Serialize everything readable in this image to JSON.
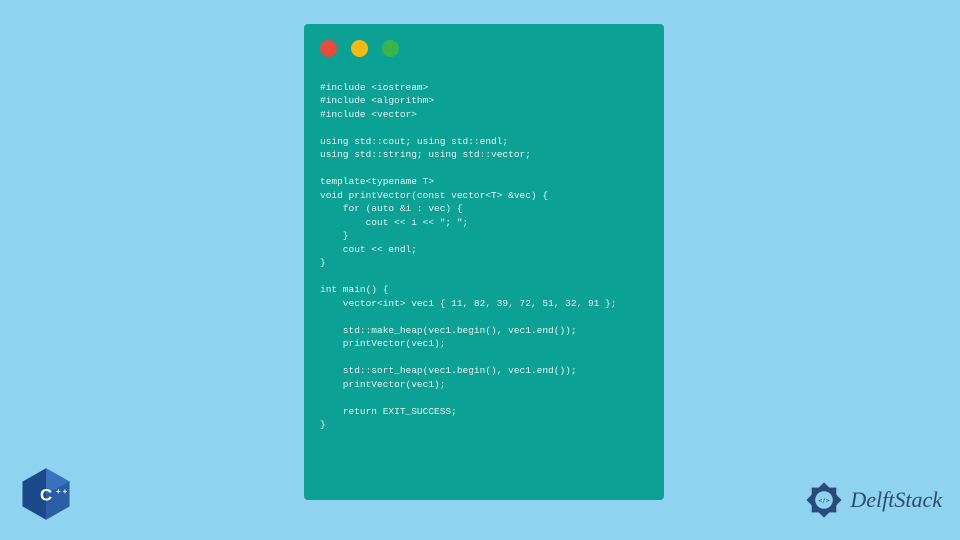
{
  "code": {
    "lines": "#include <iostream>\n#include <algorithm>\n#include <vector>\n\nusing std::cout; using std::endl;\nusing std::string; using std::vector;\n\ntemplate<typename T>\nvoid printVector(const vector<T> &vec) {\n    for (auto &i : vec) {\n        cout << i << \"; \";\n    }\n    cout << endl;\n}\n\nint main() {\n    vector<int> vec1 { 11, 82, 39, 72, 51, 32, 91 };\n\n    std::make_heap(vec1.begin(), vec1.end());\n    printVector(vec1);\n\n    std::sort_heap(vec1.begin(), vec1.end());\n    printVector(vec1);\n\n    return EXIT_SUCCESS;\n}"
  },
  "branding": {
    "cpp_label": "C++",
    "delft_label": "DelftStack"
  },
  "colors": {
    "background": "#8fd3f0",
    "window_bg": "#0ba195",
    "code_text": "#e8f5f3",
    "traffic_red": "#e94b3c",
    "traffic_yellow": "#f5b916",
    "traffic_green": "#3ab54a",
    "cpp_blue": "#1b4a8a",
    "delft_blue": "#2a4a7a"
  }
}
